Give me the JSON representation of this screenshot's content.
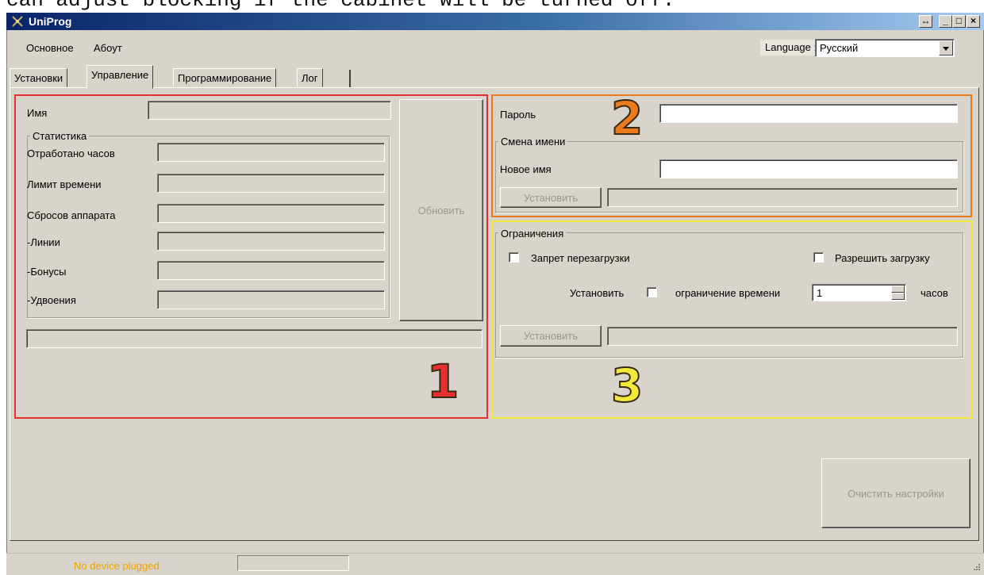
{
  "caption": "can adjust blocking if the cabinet will be turned off.",
  "window": {
    "title": "UniProg",
    "controls": [
      "↔",
      "_",
      "□",
      "×"
    ]
  },
  "menu": {
    "items": [
      "Основное",
      "Абоут"
    ]
  },
  "language": {
    "label": "Language :",
    "value": "Русский"
  },
  "tabs": [
    {
      "label": "Установки",
      "active": false
    },
    {
      "label": "Управление",
      "active": true
    },
    {
      "label": "Программирование",
      "active": false
    },
    {
      "label": "Лог",
      "active": false
    }
  ],
  "info_panel": {
    "name_label": "Имя",
    "stats_title": "Статистика",
    "stats_rows": [
      "Отработано часов",
      "Лимит времени",
      "Сбросов аппарата",
      "-Линии",
      "-Бонусы",
      "-Удвоения"
    ],
    "refresh_button": "Обновить",
    "number": "1"
  },
  "password_panel": {
    "password_label": "Пароль",
    "rename_title": "Смена имени",
    "new_name_label": "Новое имя",
    "set_button": "Установить",
    "number": "2"
  },
  "restrictions_panel": {
    "title": "Ограничения",
    "no_reload_label": "Запрет перезагрузки",
    "allow_load_label": "Разрешить загрузку",
    "set_label": "Установить",
    "time_limit_label": "ограничение времени",
    "hours_value": "1",
    "hours_unit": "часов",
    "set_button": "Установить",
    "number": "3"
  },
  "clear_settings_button": "Очистить настройки",
  "status": {
    "device": "No device plugged"
  },
  "colors": {
    "window_bg": "#d8d3cb",
    "highlight_1": "#e53030",
    "highlight_2": "#ea7a1e",
    "highlight_3": "#f2e93a",
    "status_text": "#f0a300"
  },
  "icons": [
    "app-icon",
    "dropdown-arrow-icon",
    "spin-up-icon",
    "spin-down-icon",
    "size-grip-icon"
  ]
}
